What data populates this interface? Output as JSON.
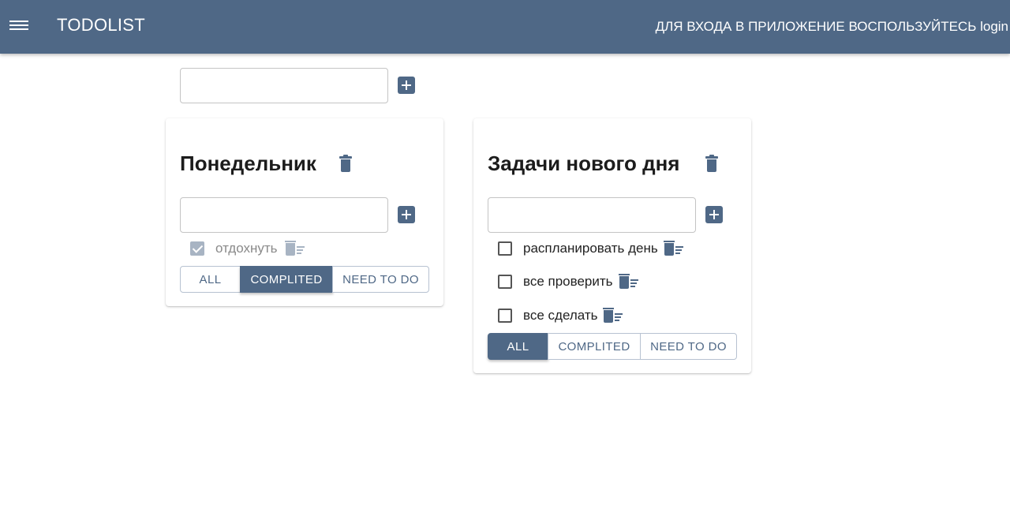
{
  "app": {
    "title": "TODOLIST",
    "login_hint": "ДЛЯ ВХОДА В ПРИЛОЖЕНИЕ ВОСПОЛЬЗУЙТЕСЬ login",
    "accent_color": "#4f6886",
    "icons": {
      "menu": "hamburger-menu-icon",
      "add": "plus-square-icon",
      "delete_list": "trash-icon",
      "delete_task": "trash-list-icon"
    }
  },
  "new_list": {
    "value": "",
    "placeholder": ""
  },
  "lists": [
    {
      "title": "Понедельник",
      "new_task": {
        "value": "",
        "placeholder": ""
      },
      "tasks": [
        {
          "label": "отдохнуть",
          "done": true
        }
      ],
      "filters": [
        "ALL",
        "COMPLITED",
        "NEED TO DO"
      ],
      "active_filter": "COMPLITED"
    },
    {
      "title": "Задачи нового дня",
      "new_task": {
        "value": "",
        "placeholder": ""
      },
      "tasks": [
        {
          "label": "распланировать день",
          "done": false
        },
        {
          "label": "все проверить",
          "done": false
        },
        {
          "label": "все сделать",
          "done": false
        }
      ],
      "filters": [
        "ALL",
        "COMPLITED",
        "NEED TO DO"
      ],
      "active_filter": "ALL"
    }
  ]
}
